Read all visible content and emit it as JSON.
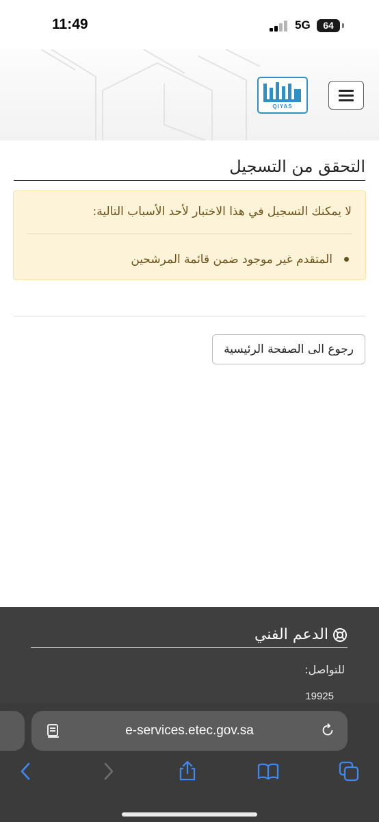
{
  "status_bar": {
    "time": "11:49",
    "network": "5G",
    "battery": "64"
  },
  "header": {
    "logo_text": "QIYAS",
    "menu_icon": "hamburger-icon"
  },
  "page": {
    "title": "التحقق من التسجيل",
    "alert": {
      "heading": "لا يمكنك التسجيل في هذا الاختبار لأحد الأسباب التالية:",
      "items": [
        "المتقدم غير موجود ضمن قائمة المرشحين"
      ]
    },
    "home_button": "رجوع الى الصفحة الرئيسية"
  },
  "footer": {
    "support_title": "الدعم الفني",
    "contact_label": "للتواصل:",
    "contact_number": "19925"
  },
  "browser": {
    "url": "e-services.etec.gov.sa"
  },
  "colors": {
    "alert_bg": "#fdf3d8",
    "alert_text": "#6b5116",
    "logo_blue": "#2f8fc7",
    "footer_bg": "#3f3f3f",
    "browser_accent": "#3d8bf2"
  }
}
